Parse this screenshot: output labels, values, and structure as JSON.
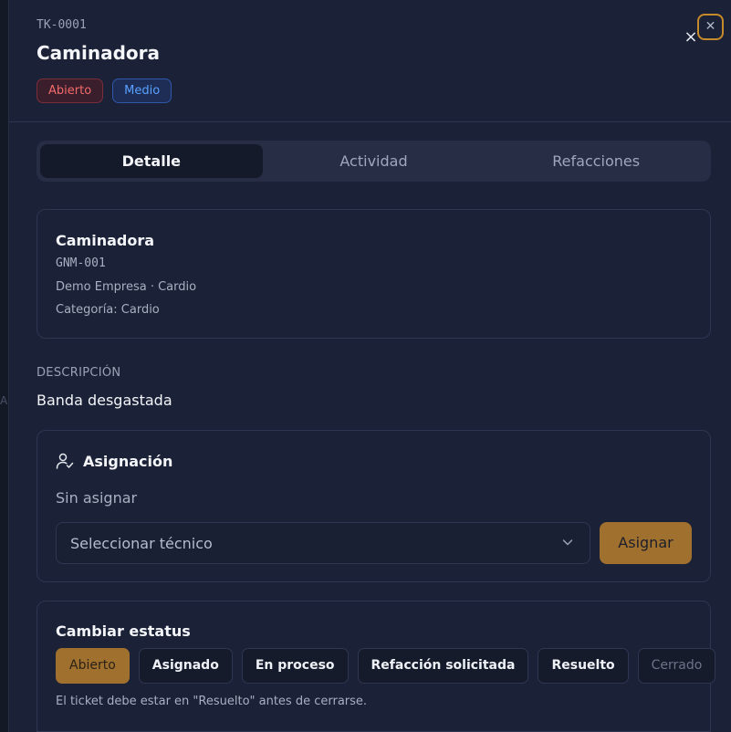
{
  "backdrop": {
    "ghost_char": "A"
  },
  "ticket": {
    "id": "TK-0001",
    "title": "Caminadora",
    "status_badge": "Abierto",
    "priority_badge": "Medio"
  },
  "header": {
    "close_glyph": "×",
    "close_focus_glyph": "✕"
  },
  "tabs": [
    {
      "label": "Detalle",
      "active": true
    },
    {
      "label": "Actividad",
      "active": false
    },
    {
      "label": "Refacciones",
      "active": false
    }
  ],
  "equipment": {
    "name": "Caminadora",
    "code": "GNM-001",
    "location": "Demo Empresa · Cardio",
    "category": "Categoría: Cardio"
  },
  "description": {
    "label": "DESCRIPCIÓN",
    "text": "Banda desgastada"
  },
  "assignment": {
    "title": "Asignación",
    "current": "Sin asignar",
    "select_value": "Seleccionar técnico",
    "assign_button": "Asignar",
    "icons": {
      "user": "user-check-icon",
      "chevron": "chevron-down-icon"
    }
  },
  "status_change": {
    "title": "Cambiar estatus",
    "options": [
      {
        "label": "Abierto",
        "selected": true,
        "disabled": false
      },
      {
        "label": "Asignado",
        "selected": false,
        "disabled": false
      },
      {
        "label": "En proceso",
        "selected": false,
        "disabled": false
      },
      {
        "label": "Refacción solicitada",
        "selected": false,
        "disabled": false
      },
      {
        "label": "Resuelto",
        "selected": false,
        "disabled": false
      },
      {
        "label": "Cerrado",
        "selected": false,
        "disabled": true
      }
    ],
    "note": "El ticket debe estar en \"Resuelto\" antes de cerrarse."
  },
  "colors": {
    "background": "#1b2136",
    "accent": "#a0702e",
    "focus_ring": "#c58a2a",
    "badge_red": "#f26b6b",
    "badge_blue": "#5aa2ff"
  }
}
